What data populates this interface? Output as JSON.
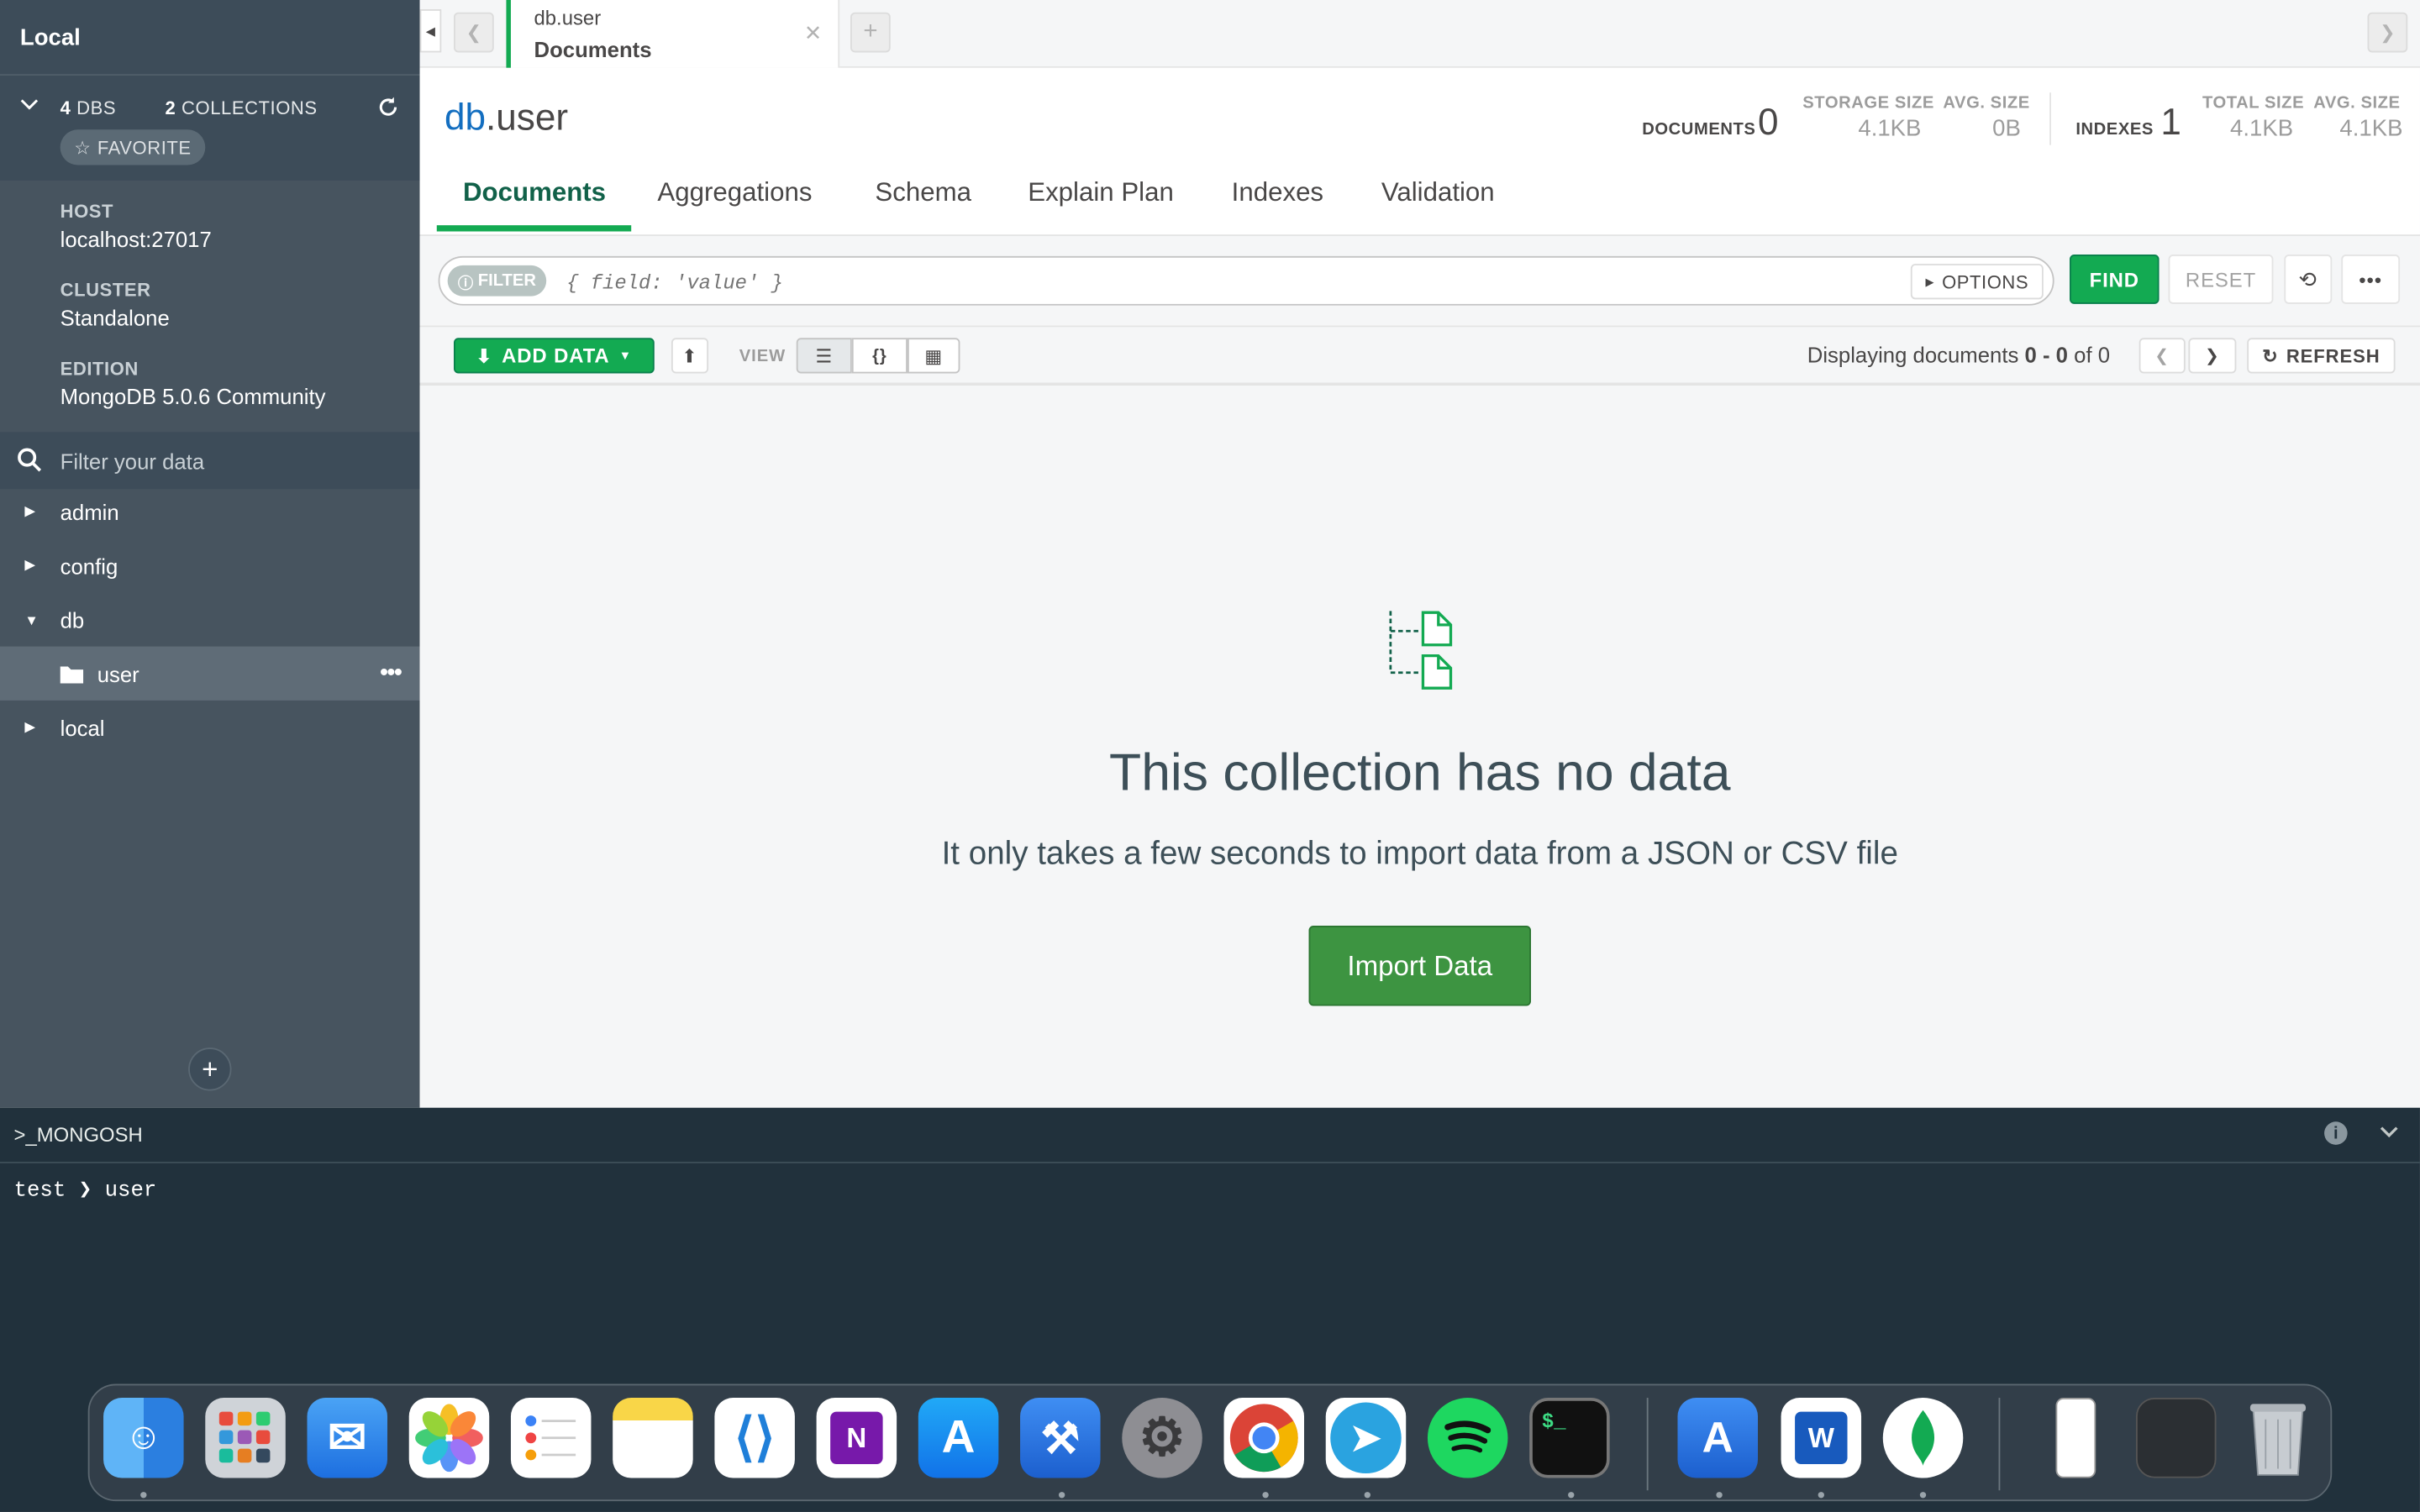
{
  "sidebar": {
    "title": "Local",
    "dbs_count": "4",
    "dbs_label": "DBS",
    "collections_count": "2",
    "collections_label": "COLLECTIONS",
    "favorite_label": "FAVORITE",
    "host_label": "HOST",
    "host_value": "localhost:27017",
    "cluster_label": "CLUSTER",
    "cluster_value": "Standalone",
    "edition_label": "EDITION",
    "edition_value": "MongoDB 5.0.6 Community",
    "filter_placeholder": "Filter your data",
    "databases": [
      {
        "name": "admin"
      },
      {
        "name": "config"
      },
      {
        "name": "db",
        "collections": [
          {
            "name": "user"
          }
        ]
      },
      {
        "name": "local"
      }
    ],
    "add_label": "+"
  },
  "tabs": [
    {
      "namespace": "db.user",
      "title": "Documents"
    }
  ],
  "header": {
    "db": "db",
    "collection": ".user",
    "documents_label": "DOCUMENTS",
    "documents_value": "0",
    "storage_size_label": "STORAGE SIZE",
    "storage_size_value": "4.1KB",
    "avg_size_label": "AVG. SIZE",
    "avg_size_value": "0B",
    "indexes_label": "INDEXES",
    "indexes_value": "1",
    "total_size_label": "TOTAL SIZE",
    "total_size_value": "4.1KB",
    "idx_avg_size_label": "AVG. SIZE",
    "idx_avg_size_value": "4.1KB"
  },
  "subtabs": [
    "Documents",
    "Aggregations",
    "Schema",
    "Explain Plan",
    "Indexes",
    "Validation"
  ],
  "query": {
    "filter_label": "FILTER",
    "filter_placeholder": "{ field: 'value' }",
    "options_label": "OPTIONS",
    "find_label": "FIND",
    "reset_label": "RESET"
  },
  "toolbar": {
    "add_data_label": "ADD DATA",
    "view_label": "VIEW",
    "displaying_prefix": "Displaying documents ",
    "range_start": "0",
    "range_sep": " - ",
    "range_end": "0",
    "of_label": " of 0",
    "refresh_label": "REFRESH"
  },
  "empty": {
    "title": "This collection has no data",
    "subtitle": "It only takes a few seconds to import data from a JSON or CSV file",
    "import_label": "Import Data"
  },
  "shell": {
    "title": ">_MONGOSH",
    "prompt": "test",
    "command": "user"
  },
  "dock": {
    "apps": [
      "finder-icon",
      "launchpad-icon",
      "mail-icon",
      "photos-icon",
      "reminders-icon",
      "notes-icon",
      "vscode-icon",
      "onenote-icon",
      "app-store-icon",
      "xcode-icon",
      "system-preferences-icon",
      "chrome-icon",
      "telegram-icon",
      "spotify-icon",
      "terminal-icon",
      "simulator-icon",
      "word-icon",
      "mongodb-compass-icon",
      "iphone-window-icon",
      "screenshot-window-icon",
      "trash-icon"
    ]
  },
  "colors": {
    "accent": "#13aa52",
    "sidebar": "#47545f",
    "shell": "#21313c",
    "link": "#136ec0"
  }
}
